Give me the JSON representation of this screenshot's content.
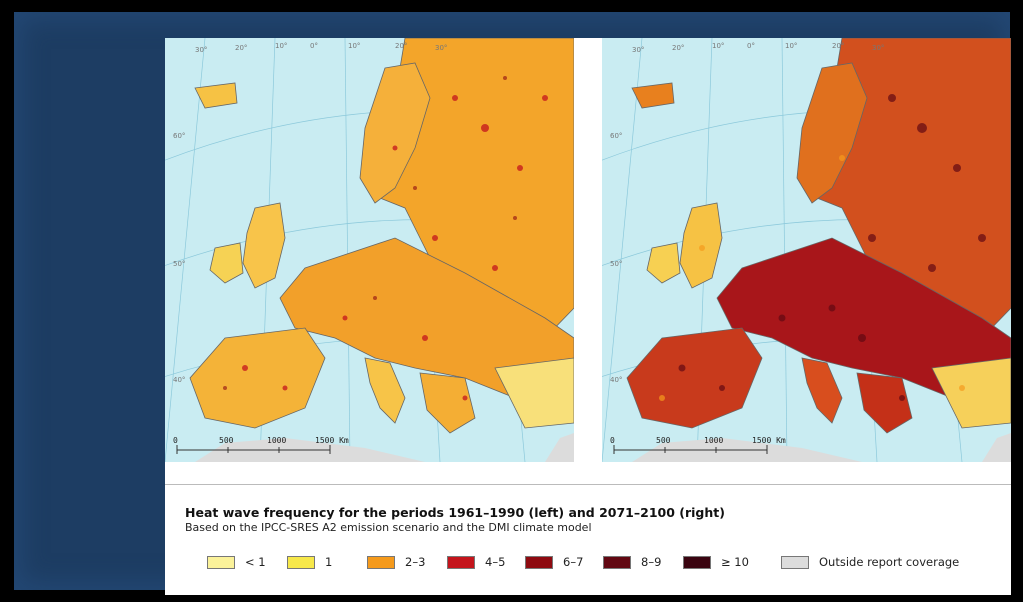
{
  "map_left": {
    "scale_labels": [
      "0",
      "500",
      "1000",
      "1500 Km"
    ],
    "graticule_labels": [
      "30°",
      "20°",
      "10°",
      "0°",
      "10°",
      "20°",
      "30°",
      "60°",
      "50°",
      "40°"
    ]
  },
  "map_right": {
    "scale_labels": [
      "0",
      "500",
      "1000",
      "1500 Km"
    ],
    "graticule_labels": [
      "30°",
      "20°",
      "10°",
      "0°",
      "10°",
      "20°",
      "30°",
      "60°",
      "50°",
      "40°"
    ]
  },
  "caption": {
    "title": "Heat wave frequency for the periods 1961–1990 (left) and 2071–2100 (right)",
    "subtitle": "Based on the IPCC-SRES A2 emission scenario and the DMI climate model"
  },
  "legend": [
    {
      "label": "< 1",
      "color": "#fbf29a"
    },
    {
      "label": "1",
      "color": "#f7e84a"
    },
    {
      "label": "2–3",
      "color": "#f59a1c"
    },
    {
      "label": "4–5",
      "color": "#c4141c"
    },
    {
      "label": "6–7",
      "color": "#8e0a10"
    },
    {
      "label": "8–9",
      "color": "#620812"
    },
    {
      "label": "≥ 10",
      "color": "#3a0410"
    },
    {
      "label": "Outside report coverage",
      "color": "#dcdcdc"
    }
  ],
  "colors": {
    "sea": "#c9ecf2",
    "frame": "#1d3d63",
    "borders": "#555555"
  }
}
